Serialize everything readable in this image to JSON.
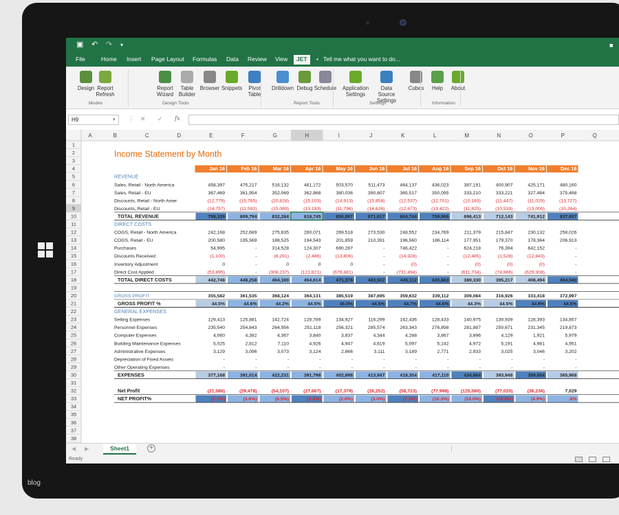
{
  "quick_access": {
    "save_icon": "save-icon",
    "undo_icon": "undo-icon",
    "redo_icon": "redo-icon",
    "customize_icon": "customize-icon"
  },
  "tabs": [
    "File",
    "Home",
    "Insert",
    "Page Layout",
    "Formulas",
    "Data",
    "Review",
    "View",
    "JET"
  ],
  "tell_me": "Tell me what you want to do...",
  "ribbon": {
    "buttons": [
      [
        "Design",
        ""
      ],
      [
        "Report",
        "Refresh"
      ],
      [
        "Report",
        "Wizard"
      ],
      [
        "Table",
        "Builder"
      ],
      [
        "Browser",
        ""
      ],
      [
        "Snippets",
        ""
      ],
      [
        "Pivot",
        "Table"
      ],
      [
        "Drilldown",
        ""
      ],
      [
        "Debug",
        ""
      ],
      [
        "Schedule",
        ""
      ],
      [
        "Application",
        "Settings"
      ],
      [
        "Data Source",
        "Settings"
      ],
      [
        "Cubes",
        ""
      ],
      [
        "Help",
        ""
      ],
      [
        "About",
        ""
      ]
    ],
    "groups": [
      "Modes",
      "Design Tools",
      "Report Tools",
      "Settings",
      "Information"
    ]
  },
  "formula_bar": {
    "name_box": "H9",
    "fx": "fx"
  },
  "column_letters": [
    "A",
    "B",
    "C",
    "D",
    "E",
    "F",
    "G",
    "H",
    "I",
    "J",
    "K",
    "L",
    "M",
    "N",
    "O",
    "P",
    "Q"
  ],
  "sheet": {
    "title": "Income Statement by Month",
    "months": [
      "Jan 16",
      "Feb 16",
      "Mar 16",
      "Apr 16",
      "May 16",
      "Jun 16",
      "Jul 16",
      "Aug 16",
      "Sep 16",
      "Oct 16",
      "Nov 16",
      "Dec 16"
    ],
    "sections": {
      "revenue": "REVENUE",
      "direct_costs": "DIRECT COSTS",
      "gross_profit": "GROSS PROFIT",
      "general_expenses": "GENERAL EXPENSES"
    },
    "rows": [
      {
        "r": 6,
        "label": "Sales, Retail - North America",
        "v": [
          "458,397",
          "475,217",
          "516,132",
          "461,172",
          "503,570",
          "511,473",
          "464,137",
          "436,023",
          "387,191",
          "400,907",
          "425,171",
          "480,160"
        ]
      },
      {
        "r": 7,
        "label": "Sales, Retail - EU",
        "v": [
          "367,469",
          "361,954",
          "352,069",
          "362,868",
          "380,036",
          "390,607",
          "365,517",
          "350,095",
          "333,210",
          "333,221",
          "327,484",
          "375,488"
        ]
      },
      {
        "r": 8,
        "label": "Discounts, Retail - North Amer",
        "v": [
          "(12,779)",
          "(15,765)",
          "(20,828)",
          "(15,103)",
          "(14,913)",
          "(15,858)",
          "(12,537)",
          "(12,701)",
          "(10,183)",
          "(11,447)",
          "(11,029)",
          "(13,727)"
        ]
      },
      {
        "r": 9,
        "label": "Discounts, Retail - EU",
        "v": [
          "(14,757)",
          "(11,592)",
          "(15,089)",
          "(13,193)",
          "(11,796)",
          "(14,626)",
          "(12,673)",
          "(13,422)",
          "(11,825)",
          "(10,539)",
          "(13,009)",
          "(10,264)"
        ]
      },
      {
        "r": 10,
        "label": "TOTAL REVENUE",
        "v": [
          "798,329",
          "809,794",
          "832,284",
          "818,745",
          "856,897",
          "871,617",
          "804,744",
          "759,996",
          "698,413",
          "712,143",
          "741,912",
          "837,937"
        ]
      },
      {
        "r": 12,
        "label": "COGS, Retail - North America",
        "v": [
          "242,168",
          "252,689",
          "275,635",
          "260,071",
          "269,518",
          "273,530",
          "248,552",
          "234,769",
          "211,379",
          "215,847",
          "230,132",
          "258,026"
        ]
      },
      {
        "r": 13,
        "label": "COGS, Retail - EU",
        "v": [
          "200,580",
          "195,569",
          "188,525",
          "194,543",
          "201,859",
          "210,391",
          "196,560",
          "186,114",
          "177,951",
          "179,370",
          "178,364",
          "206,913"
        ]
      },
      {
        "r": 14,
        "label": "Purchases",
        "v": [
          "54,995",
          "-",
          "314,528",
          "124,307",
          "690,287",
          "-",
          "746,422",
          "-",
          "624,218",
          "76,394",
          "642,152",
          "-"
        ]
      },
      {
        "r": 15,
        "label": "Discounts Received",
        "v": [
          "(1,100)",
          "-",
          "(6,291)",
          "(2,486)",
          "(13,806)",
          "-",
          "(14,928)",
          "-",
          "(12,485)",
          "(1,528)",
          "(12,843)",
          "-"
        ]
      },
      {
        "r": 16,
        "label": "Inventory Adjustment",
        "v": [
          "0",
          "-",
          "0",
          "0",
          "0",
          "-",
          "(0)",
          "-",
          "(0)",
          "(0)",
          "(0)",
          "-"
        ]
      },
      {
        "r": 17,
        "label": "Direct Cost Applied",
        "v": [
          "(53,895)",
          "-",
          "(308,237)",
          "(121,821)",
          "(676,481)",
          "-",
          "(731,494)",
          "-",
          "(611,734)",
          "(74,866)",
          "(629,308)",
          "-"
        ]
      },
      {
        "r": 18,
        "label": "TOTAL DIRECT COSTS",
        "v": [
          "442,748",
          "448,258",
          "464,160",
          "454,614",
          "471,378",
          "483,922",
          "445,112",
          "420,883",
          "389,330",
          "395,217",
          "408,494",
          "464,940"
        ]
      },
      {
        "r": 20,
        "label": "GROSS PROFIT",
        "v": [
          "355,582",
          "361,535",
          "368,124",
          "364,131",
          "385,519",
          "387,695",
          "359,632",
          "339,112",
          "309,084",
          "316,926",
          "333,418",
          "372,997"
        ]
      },
      {
        "r": 21,
        "label": "GROSS PROFIT %",
        "v": [
          "44.5%",
          "44.6%",
          "44.2%",
          "44.5%",
          "45.0%",
          "44.5%",
          "44.7%",
          "44.6%",
          "44.3%",
          "44.5%",
          "44.9%",
          "44.5%"
        ]
      },
      {
        "r": 23,
        "label": "Selling Expenses",
        "v": [
          "129,413",
          "125,881",
          "142,724",
          "128,789",
          "134,927",
          "116,299",
          "142,436",
          "128,433",
          "140,975",
          "130,939",
          "128,393",
          "134,857"
        ]
      },
      {
        "r": 24,
        "label": "Personnel Expenses",
        "v": [
          "235,540",
          "254,843",
          "264,956",
          "251,118",
          "256,321",
          "285,574",
          "263,343",
          "276,898",
          "281,887",
          "250,671",
          "231,345",
          "219,873"
        ]
      },
      {
        "r": 25,
        "label": "Computer Expenses",
        "v": [
          "4,060",
          "4,382",
          "4,367",
          "3,840",
          "3,837",
          "4,344",
          "4,288",
          "3,867",
          "3,896",
          "4,129",
          "1,921",
          "5,979"
        ]
      },
      {
        "r": 26,
        "label": "Building Maintenance Expenses",
        "v": [
          "5,025",
          "2,812",
          "7,110",
          "4,926",
          "4,947",
          "4,619",
          "5,097",
          "5,142",
          "4,972",
          "5,191",
          "4,981",
          "4,951"
        ]
      },
      {
        "r": 27,
        "label": "Administrative Expenses",
        "v": [
          "3,129",
          "3,096",
          "3,073",
          "3,124",
          "2,866",
          "3,111",
          "3,189",
          "2,771",
          "2,933",
          "3,025",
          "3,046",
          "3,202"
        ]
      },
      {
        "r": 28,
        "label": "Depreciation of Fixed Assets",
        "v": [
          "-",
          "-",
          "-",
          "-",
          "-",
          "-",
          "-",
          "-",
          "-",
          "-",
          "-",
          "-"
        ]
      },
      {
        "r": 29,
        "label": "Other Operating Expenses",
        "v": [
          "-",
          "-",
          "-",
          "-",
          "-",
          "-",
          "-",
          "-",
          "-",
          "-",
          "-",
          "-"
        ]
      },
      {
        "r": 30,
        "label": "EXPENSES",
        "v": [
          "377,168",
          "391,014",
          "422,231",
          "391,798",
          "402,898",
          "413,947",
          "418,354",
          "417,110",
          "434,664",
          "393,946",
          "369,654",
          "365,968"
        ]
      },
      {
        "r": 32,
        "label": "Net Profit",
        "v": [
          "(21,586)",
          "(29,478)",
          "(54,107)",
          "(27,667)",
          "(17,379)",
          "(26,252)",
          "(58,723)",
          "(77,998)",
          "(125,580)",
          "(77,020)",
          "(36,236)",
          "7,029"
        ]
      },
      {
        "r": 33,
        "label": "NET PROFIT%",
        "v": [
          "(2.7%)",
          "(3.6%)",
          "(6.5%)",
          "(3.4%)",
          "(2.0%)",
          "(3.0%)",
          "(7.3%)",
          "(10.3%)",
          "(18.0%)",
          "(10.8%)",
          "(4.9%)",
          ".8%"
        ]
      }
    ]
  },
  "sheet_tab": "Sheet1",
  "status": "Ready",
  "device": {
    "caption": "blog"
  },
  "colors": {
    "excel_green": "#217346",
    "orange_header": "#f07f2d",
    "title_orange": "#e26b0a",
    "section_blue": "#4f81bd",
    "negative_red": "#e0242b",
    "band_light": "#b8cce4",
    "band_mid": "#8db3e2",
    "band_dark": "#4f81bd"
  }
}
